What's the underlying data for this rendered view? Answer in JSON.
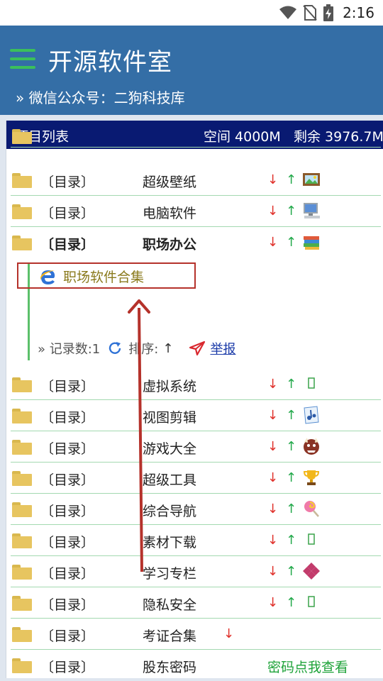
{
  "status_bar": {
    "time": "2:16",
    "icons": [
      "wifi-icon",
      "no-sim-icon",
      "battery-charging-icon"
    ]
  },
  "app_bar": {
    "title": "开源软件室",
    "subtitle": "» 微信公众号：二狗科技库",
    "menu_icon": "hamburger-menu-icon",
    "accent_color": "#346ea6"
  },
  "list_header": {
    "title": "项目列表",
    "space": "空间 4000M",
    "remaining": "剩余 3976.7M"
  },
  "rows_top": [
    {
      "tag": "〔目录〕",
      "name": "超级壁纸",
      "emoji": "picture-icon"
    },
    {
      "tag": "〔目录〕",
      "name": "电脑软件",
      "emoji": "computer-icon"
    },
    {
      "tag": "〔目录〕",
      "name": "职场办公",
      "emoji": "books-icon"
    }
  ],
  "expanded": {
    "link_label": "职场软件合集",
    "link_icon": "internet-explorer-icon",
    "count_label": "» 记录数:1",
    "sort_label": "排序:",
    "report_label": "举报"
  },
  "rows_bottom": [
    {
      "tag": "〔目录〕",
      "name": "虚拟系统",
      "emoji": "missing-glyph-icon"
    },
    {
      "tag": "〔目录〕",
      "name": "视图剪辑",
      "emoji": "music-score-icon"
    },
    {
      "tag": "〔目录〕",
      "name": "游戏大全",
      "emoji": "ogre-mask-icon"
    },
    {
      "tag": "〔目录〕",
      "name": "超级工具",
      "emoji": "trophy-icon"
    },
    {
      "tag": "〔目录〕",
      "name": "综合导航",
      "emoji": "lollipop-icon"
    },
    {
      "tag": "〔目录〕",
      "name": "素材下载",
      "emoji": "missing-glyph-icon"
    },
    {
      "tag": "〔目录〕",
      "name": "学习专栏",
      "emoji": "diamond-pattern-icon"
    },
    {
      "tag": "〔目录〕",
      "name": "隐私安全",
      "emoji": "missing-glyph-icon"
    },
    {
      "tag": "〔目录〕",
      "name": "考证合集",
      "emoji": ""
    },
    {
      "tag": "〔目录〕",
      "name": "股东密码",
      "password_link": "密码点我查看"
    }
  ],
  "arrows": {
    "down": "↓",
    "up": "↑"
  },
  "colors": {
    "header_navy": "#091a72",
    "down_red": "#e0312b",
    "up_green": "#22a84a",
    "annotation_red": "#b5322b"
  }
}
